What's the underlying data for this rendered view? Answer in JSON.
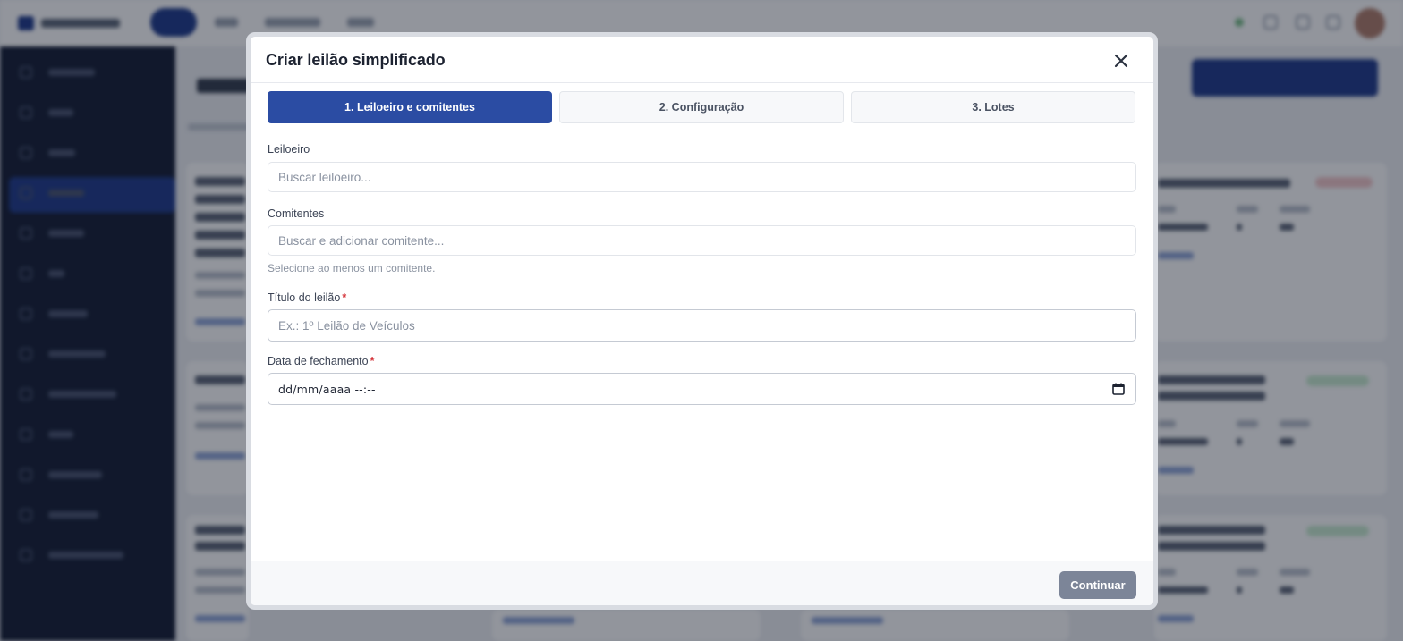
{
  "modal": {
    "title": "Criar leilão simplificado",
    "steps": [
      {
        "label": "1. Leiloeiro e comitentes",
        "active": true
      },
      {
        "label": "2. Configuração",
        "active": false
      },
      {
        "label": "3. Lotes",
        "active": false
      }
    ],
    "fields": {
      "leiloeiro": {
        "label": "Leiloeiro",
        "placeholder": "Buscar leiloeiro..."
      },
      "comitentes": {
        "label": "Comitentes",
        "placeholder": "Buscar e adicionar comitente...",
        "hint": "Selecione ao menos um comitente."
      },
      "titulo": {
        "label": "Título do leilão",
        "required_mark": "*",
        "placeholder": "Ex.: 1º Leilão de Veículos"
      },
      "data_fechamento": {
        "label": "Data de fechamento",
        "required_mark": "*",
        "value": "dd/mm/aaaa --:--"
      }
    },
    "continue_label": "Continuar"
  },
  "icons": {
    "close": "close-icon",
    "calendar": "calendar-icon"
  },
  "colors": {
    "primary": "#2b4ca3",
    "required": "#d4343a",
    "continue_disabled": "#7c8598",
    "sidebar": "#141c33"
  }
}
